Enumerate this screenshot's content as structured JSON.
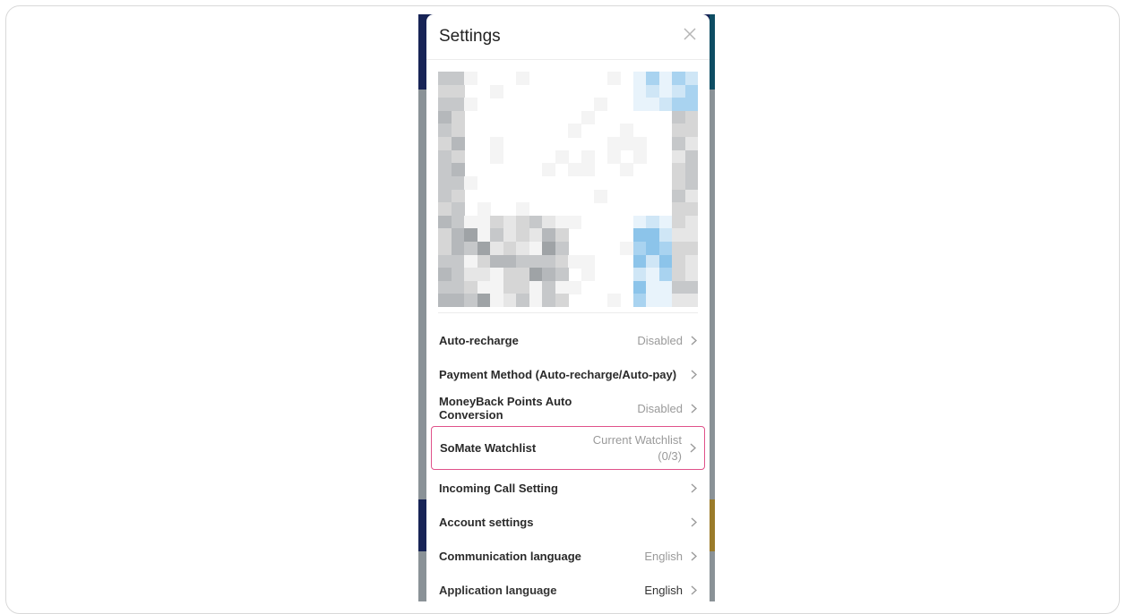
{
  "modal": {
    "title": "Settings",
    "close_icon": "close-icon"
  },
  "qr": {
    "icon": "qr-code-icon"
  },
  "settings": [
    {
      "label": "Auto-recharge",
      "value": "Disabled"
    },
    {
      "label": "Payment Method (Auto-recharge/Auto-pay)",
      "value": ""
    },
    {
      "label": "MoneyBack Points Auto Conversion",
      "value": "Disabled"
    },
    {
      "label": "SoMate Watchlist",
      "value_line1": "Current Watchlist",
      "value_line2": "(0/3)"
    },
    {
      "label": "Incoming Call Setting",
      "value": ""
    },
    {
      "label": "Account settings",
      "value": ""
    },
    {
      "label": "Communication language",
      "value": "English"
    },
    {
      "label": "Application language",
      "value": "English"
    }
  ],
  "colors": {
    "highlight_border": "#e0528a",
    "background_navy": "#172456",
    "background_gray": "#8a9297"
  }
}
